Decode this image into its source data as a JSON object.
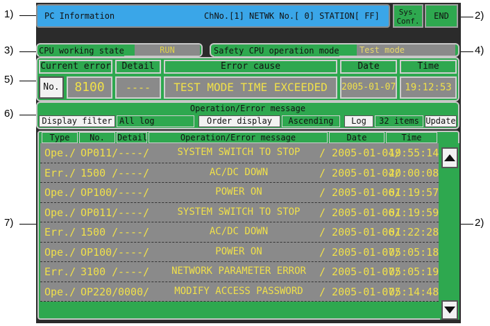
{
  "callouts": {
    "c1": "1)",
    "c2a": "2)",
    "c3": "3)",
    "c4": "4)",
    "c5": "5)",
    "c6": "6)",
    "c7": "7)",
    "c2b": "2)"
  },
  "header": {
    "title": "PC Information",
    "station": "ChNo.[1] NETWK No.[  0] STATION[ FF]",
    "sysconf_label": "Sys.\nConf.",
    "end_label": "END"
  },
  "cpu": {
    "working_state_label": "CPU working state",
    "working_state_value": "RUN",
    "safety_mode_label": "Safety CPU operation mode",
    "safety_mode_value": "Test mode"
  },
  "current_error": {
    "headers": [
      "Current error",
      "Detail",
      "Error cause",
      "Date",
      "Time"
    ],
    "no_label": "No.",
    "number": "8100",
    "detail": "----",
    "cause": "TEST MODE TIME EXCEEDED",
    "date": "2005-01-07",
    "time": "19:12:53"
  },
  "message_panel": {
    "title": "Operation/Error message",
    "display_filter_label": "Display filter",
    "filter_value": "All log",
    "order_label": "Order display",
    "order_value": "Ascending",
    "log_label": "Log",
    "log_count": "32 items",
    "update_label": "Update"
  },
  "log_table": {
    "columns": [
      "Type",
      "No.",
      "Detail",
      "Operation/Error message",
      "Date",
      "Time"
    ],
    "rows": [
      {
        "type": "Ope./",
        "no": "OP011/",
        "detail": "----/",
        "message": "SYSTEM SWITCH TO STOP",
        "date": "/ 2005-01-04/",
        "time": "19:55:14"
      },
      {
        "type": "Err./",
        "no": "1500 /",
        "detail": "----/",
        "message": "AC/DC DOWN",
        "date": "/ 2005-01-04/",
        "time": "20:00:08"
      },
      {
        "type": "Ope./",
        "no": "OP100/",
        "detail": "----/",
        "message": "POWER ON",
        "date": "/ 2005-01-06/",
        "time": "01:19:57"
      },
      {
        "type": "Ope./",
        "no": "OP011/",
        "detail": "----/",
        "message": "SYSTEM SWITCH TO STOP",
        "date": "/ 2005-01-06/",
        "time": "01:19:59"
      },
      {
        "type": "Err./",
        "no": "1500 /",
        "detail": "----/",
        "message": "AC/DC DOWN",
        "date": "/ 2005-01-06/",
        "time": "01:22:28"
      },
      {
        "type": "Ope./",
        "no": "OP100/",
        "detail": "----/",
        "message": "POWER ON",
        "date": "/ 2005-01-07/",
        "time": "05:05:18"
      },
      {
        "type": "Err./",
        "no": "3100 /",
        "detail": "----/",
        "message": "NETWORK PARAMETER ERROR",
        "date": "/ 2005-01-07/",
        "time": "05:05:19"
      },
      {
        "type": "Ope./",
        "no": "OP220/",
        "detail": "0000/",
        "message": "MODIFY ACCESS PASSWORD",
        "date": "/ 2005-01-07/",
        "time": "05:14:48"
      }
    ]
  },
  "colors": {
    "title_blue": "#3aa6e8",
    "panel_green": "#2ea84f",
    "value_gray": "#8a8a8a",
    "value_yellow": "#f0e04a"
  },
  "icons": {
    "scroll_up": "triangle-up-icon",
    "scroll_down": "triangle-down-icon"
  }
}
